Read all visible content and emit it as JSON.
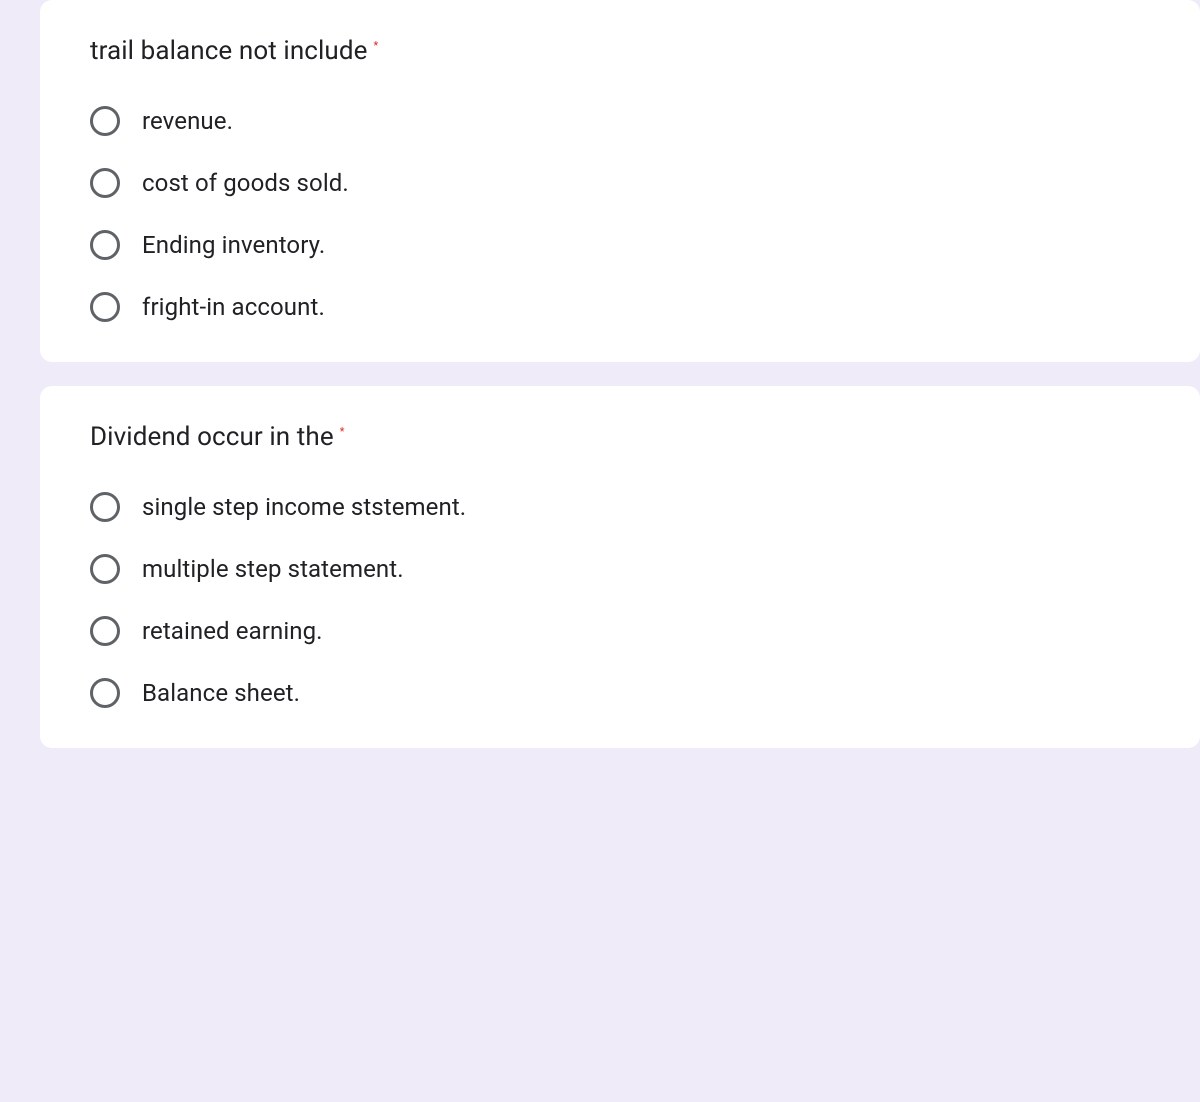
{
  "questions": [
    {
      "text": "trail balance not include",
      "required_marker": "*",
      "options": [
        {
          "label": "revenue."
        },
        {
          "label": "cost of goods sold."
        },
        {
          "label": "Ending inventory."
        },
        {
          "label": "fright-in account."
        }
      ]
    },
    {
      "text": "Dividend occur in the",
      "required_marker": "*",
      "options": [
        {
          "label": "single step income ststement."
        },
        {
          "label": "multiple step statement."
        },
        {
          "label": "retained earning."
        },
        {
          "label": "Balance sheet."
        }
      ]
    }
  ]
}
